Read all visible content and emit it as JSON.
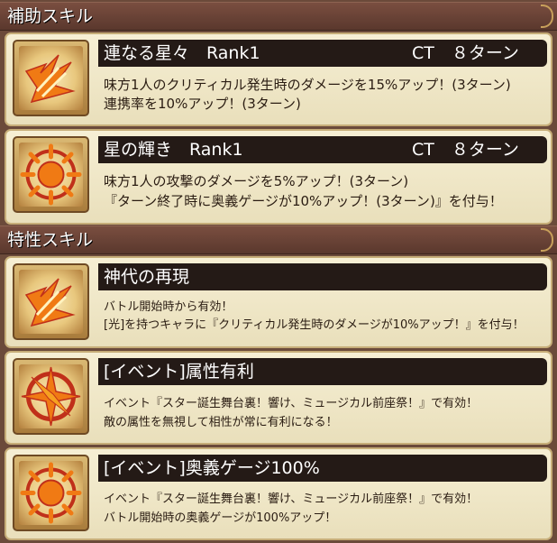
{
  "sections": {
    "support": {
      "title": "補助スキル"
    },
    "trait": {
      "title": "特性スキル"
    }
  },
  "support_skills": [
    {
      "name": "連なる星々　Rank1",
      "ct": "CT　８ターン",
      "icon": "flame-sword-icon",
      "lines": [
        "味方1人のクリティカル発生時のダメージを15%アップ！(3ターン)",
        "連携率を10%アップ！(3ターン)"
      ]
    },
    {
      "name": "星の輝き　Rank1",
      "ct": "CT　８ターン",
      "icon": "sun-burst-icon",
      "lines": [
        "味方1人の攻撃のダメージを5%アップ！(3ターン)",
        "『ターン終了時に奥義ゲージが10%アップ！(3ターン)』を付与！"
      ]
    }
  ],
  "trait_skills": [
    {
      "name": "神代の再現",
      "icon": "flame-sword-icon",
      "lines": [
        "バトル開始時から有効！",
        "[光]を持つキャラに『クリティカル発生時のダメージが10%アップ！』を付与！"
      ]
    },
    {
      "name": "[イベント]属性有利",
      "icon": "compass-star-icon",
      "lines": [
        "イベント『スター誕生舞台裏！響け、ミュージカル前座祭！』で有効！",
        "敵の属性を無視して相性が常に有利になる！"
      ]
    },
    {
      "name": "[イベント]奥義ゲージ100%",
      "icon": "sun-burst-icon",
      "lines": [
        "イベント『スター誕生舞台裏！響け、ミュージカル前座祭！』で有効！",
        "バトル開始時の奥義ゲージが100%アップ！"
      ]
    }
  ],
  "colors": {
    "page_bg": "#6b4a3a",
    "card_bg": "#f6efd4",
    "name_bar": "#241a16",
    "icon_orange": "#f07a14",
    "icon_red": "#c0301a"
  }
}
